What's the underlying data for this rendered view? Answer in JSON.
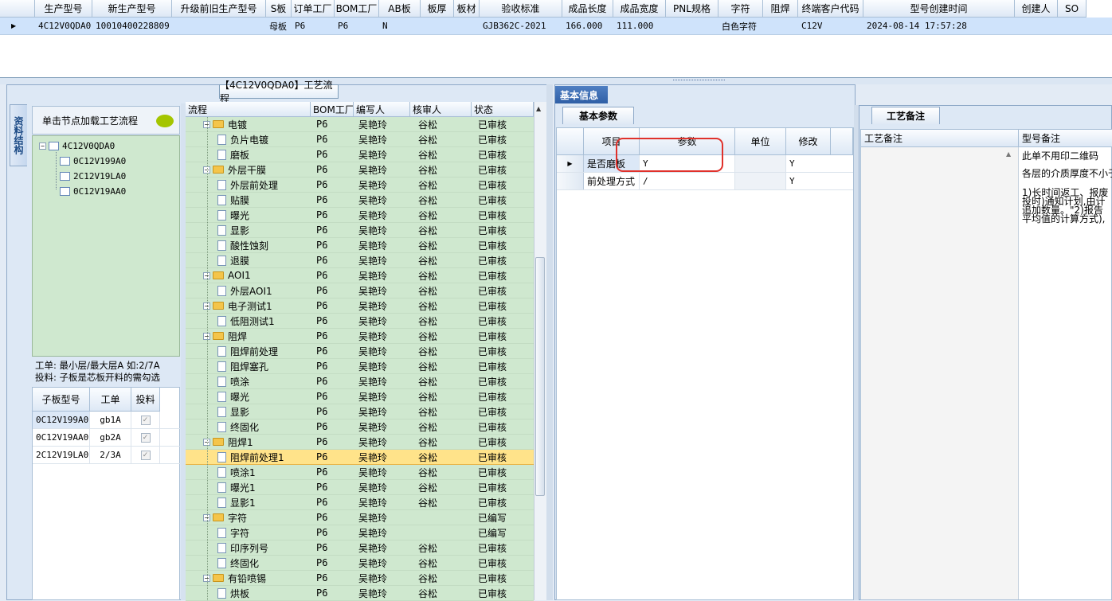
{
  "top_grid": {
    "columns": [
      "生产型号",
      "新生产型号",
      "升级前旧生产型号",
      "S板",
      "订单工厂",
      "BOM工厂",
      "AB板",
      "板厚",
      "板材",
      "验收标准",
      "成品长度",
      "成品宽度",
      "PNL规格",
      "字符",
      "阻焊",
      "终端客户代码",
      "型号创建时间",
      "创建人",
      "SO"
    ],
    "row": [
      "4C12V0QDA0",
      "10010400228809",
      "",
      "母板",
      "P6",
      "P6",
      "N",
      "",
      "",
      "GJB362C-2021",
      "166.000",
      "111.000",
      "",
      "白色字符",
      "",
      "C12V",
      "2024-08-14 17:57:28",
      "",
      ""
    ]
  },
  "flow_panel": {
    "title": "【4C12V0QDA0】工艺流程",
    "side_tab": "资料结构",
    "hint": "单击节点加载工艺流程",
    "tree": [
      {
        "label": "4C12V0QDA0",
        "level": 0
      },
      {
        "label": "0C12V199A0",
        "level": 1
      },
      {
        "label": "2C12V19LA0",
        "level": 1
      },
      {
        "label": "0C12V19AA0",
        "level": 1
      }
    ],
    "note_line1": "工单: 最小层/最大层A 如:2/7A",
    "note_line2": "投料: 子板是芯板开料的需勾选",
    "sub_columns": [
      "子板型号",
      "工单",
      "投料"
    ],
    "sub_rows": [
      {
        "model": "0C12V199A0",
        "order": "gb1A",
        "check": "✓"
      },
      {
        "model": "0C12V19AA0",
        "order": "gb2A",
        "check": "✓"
      },
      {
        "model": "2C12V19LA0",
        "order": "2/3A",
        "check": "✓"
      }
    ],
    "flow_columns": [
      "流程",
      "BOM工厂",
      "编写人",
      "核审人",
      "状态"
    ],
    "flow_rows": [
      {
        "name": "电镀",
        "folder": true,
        "bom": "P6",
        "writer": "吴艳玲",
        "reviewer": "谷松",
        "status": "已审核"
      },
      {
        "name": "负片电镀",
        "folder": false,
        "bom": "P6",
        "writer": "吴艳玲",
        "reviewer": "谷松",
        "status": "已审核"
      },
      {
        "name": "磨板",
        "folder": false,
        "bom": "P6",
        "writer": "吴艳玲",
        "reviewer": "谷松",
        "status": "已审核"
      },
      {
        "name": "外层干膜",
        "folder": true,
        "bom": "P6",
        "writer": "吴艳玲",
        "reviewer": "谷松",
        "status": "已审核"
      },
      {
        "name": "外层前处理",
        "folder": false,
        "bom": "P6",
        "writer": "吴艳玲",
        "reviewer": "谷松",
        "status": "已审核"
      },
      {
        "name": "贴膜",
        "folder": false,
        "bom": "P6",
        "writer": "吴艳玲",
        "reviewer": "谷松",
        "status": "已审核"
      },
      {
        "name": "曝光",
        "folder": false,
        "bom": "P6",
        "writer": "吴艳玲",
        "reviewer": "谷松",
        "status": "已审核"
      },
      {
        "name": "显影",
        "folder": false,
        "bom": "P6",
        "writer": "吴艳玲",
        "reviewer": "谷松",
        "status": "已审核"
      },
      {
        "name": "酸性蚀刻",
        "folder": false,
        "bom": "P6",
        "writer": "吴艳玲",
        "reviewer": "谷松",
        "status": "已审核"
      },
      {
        "name": "退膜",
        "folder": false,
        "bom": "P6",
        "writer": "吴艳玲",
        "reviewer": "谷松",
        "status": "已审核"
      },
      {
        "name": "AOI1",
        "folder": true,
        "bom": "P6",
        "writer": "吴艳玲",
        "reviewer": "谷松",
        "status": "已审核"
      },
      {
        "name": "外层AOI1",
        "folder": false,
        "bom": "P6",
        "writer": "吴艳玲",
        "reviewer": "谷松",
        "status": "已审核"
      },
      {
        "name": "电子测试1",
        "folder": true,
        "bom": "P6",
        "writer": "吴艳玲",
        "reviewer": "谷松",
        "status": "已审核"
      },
      {
        "name": "低阻测试1",
        "folder": false,
        "bom": "P6",
        "writer": "吴艳玲",
        "reviewer": "谷松",
        "status": "已审核"
      },
      {
        "name": "阻焊",
        "folder": true,
        "bom": "P6",
        "writer": "吴艳玲",
        "reviewer": "谷松",
        "status": "已审核"
      },
      {
        "name": "阻焊前处理",
        "folder": false,
        "bom": "P6",
        "writer": "吴艳玲",
        "reviewer": "谷松",
        "status": "已审核"
      },
      {
        "name": "阻焊塞孔",
        "folder": false,
        "bom": "P6",
        "writer": "吴艳玲",
        "reviewer": "谷松",
        "status": "已审核"
      },
      {
        "name": "喷涂",
        "folder": false,
        "bom": "P6",
        "writer": "吴艳玲",
        "reviewer": "谷松",
        "status": "已审核"
      },
      {
        "name": "曝光",
        "folder": false,
        "bom": "P6",
        "writer": "吴艳玲",
        "reviewer": "谷松",
        "status": "已审核"
      },
      {
        "name": "显影",
        "folder": false,
        "bom": "P6",
        "writer": "吴艳玲",
        "reviewer": "谷松",
        "status": "已审核"
      },
      {
        "name": "终固化",
        "folder": false,
        "bom": "P6",
        "writer": "吴艳玲",
        "reviewer": "谷松",
        "status": "已审核"
      },
      {
        "name": "阻焊1",
        "folder": true,
        "bom": "P6",
        "writer": "吴艳玲",
        "reviewer": "谷松",
        "status": "已审核"
      },
      {
        "name": "阻焊前处理1",
        "folder": false,
        "bom": "P6",
        "writer": "吴艳玲",
        "reviewer": "谷松",
        "status": "已审核",
        "selected": true
      },
      {
        "name": "喷涂1",
        "folder": false,
        "bom": "P6",
        "writer": "吴艳玲",
        "reviewer": "谷松",
        "status": "已审核"
      },
      {
        "name": "曝光1",
        "folder": false,
        "bom": "P6",
        "writer": "吴艳玲",
        "reviewer": "谷松",
        "status": "已审核"
      },
      {
        "name": "显影1",
        "folder": false,
        "bom": "P6",
        "writer": "吴艳玲",
        "reviewer": "谷松",
        "status": "已审核"
      },
      {
        "name": "字符",
        "folder": true,
        "bom": "P6",
        "writer": "吴艳玲",
        "reviewer": "",
        "status": "已编写"
      },
      {
        "name": "字符",
        "folder": false,
        "bom": "P6",
        "writer": "吴艳玲",
        "reviewer": "",
        "status": "已编写"
      },
      {
        "name": "印序列号",
        "folder": false,
        "bom": "P6",
        "writer": "吴艳玲",
        "reviewer": "谷松",
        "status": "已审核"
      },
      {
        "name": "终固化",
        "folder": false,
        "bom": "P6",
        "writer": "吴艳玲",
        "reviewer": "谷松",
        "status": "已审核"
      },
      {
        "name": "有铅喷锡",
        "folder": true,
        "bom": "P6",
        "writer": "吴艳玲",
        "reviewer": "谷松",
        "status": "已审核"
      },
      {
        "name": "烘板",
        "folder": false,
        "bom": "P6",
        "writer": "吴艳玲",
        "reviewer": "谷松",
        "status": "已审核"
      }
    ]
  },
  "basic_info": {
    "title": "基本信息",
    "tab": "基本参数",
    "columns": [
      "项目",
      "参数",
      "单位",
      "修改"
    ],
    "rows": [
      {
        "item": "是否磨板",
        "param": "Y",
        "unit": "",
        "modify": "Y"
      },
      {
        "item": "前处理方式",
        "param": "/",
        "unit": "",
        "modify": "Y"
      }
    ]
  },
  "process_notes": {
    "tab": "工艺备注",
    "col1": "工艺备注",
    "col2": "型号备注",
    "lines": [
      "此单不用印二维码",
      "各层的介质厚度不小于",
      "1)长时间返工、报废",
      "投时)通知计划,由计",
      "追加数量。\"2)报告",
      "平均值的计算方式),"
    ]
  }
}
